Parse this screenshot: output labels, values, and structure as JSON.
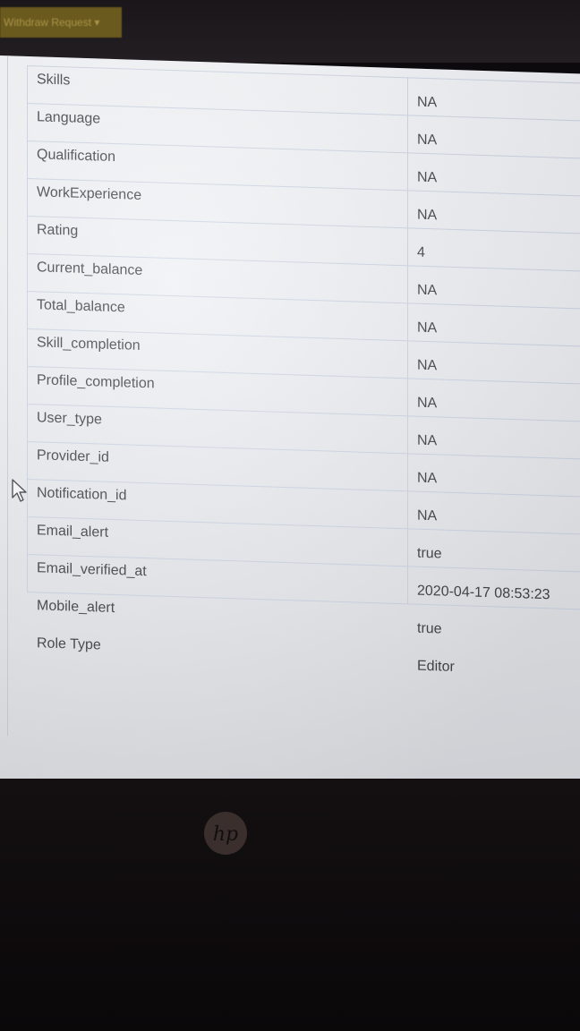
{
  "toolbar": {
    "withdraw_label": "Withdraw Request ▾"
  },
  "details": {
    "rows": [
      {
        "label": "Skills",
        "value": "NA"
      },
      {
        "label": "Language",
        "value": "NA"
      },
      {
        "label": "Qualification",
        "value": "NA"
      },
      {
        "label": "WorkExperience",
        "value": "NA"
      },
      {
        "label": "Rating",
        "value": "4"
      },
      {
        "label": "Current_balance",
        "value": "NA"
      },
      {
        "label": "Total_balance",
        "value": "NA"
      },
      {
        "label": "Skill_completion",
        "value": "NA"
      },
      {
        "label": "Profile_completion",
        "value": "NA"
      },
      {
        "label": "User_type",
        "value": "NA"
      },
      {
        "label": "Provider_id",
        "value": "NA"
      },
      {
        "label": "Notification_id",
        "value": "NA"
      },
      {
        "label": "Email_alert",
        "value": "true"
      },
      {
        "label": "Email_verified_at",
        "value": "2020-04-17 08:53:23"
      },
      {
        "label": "Mobile_alert",
        "value": "true"
      },
      {
        "label": "Role Type",
        "value": "Editor"
      }
    ]
  },
  "icons": {
    "cursor": "mouse-pointer-icon",
    "laptop_logo": "hp-logo-icon"
  },
  "colors": {
    "withdraw_button_bg": "#6a5a1e",
    "screen_bg": "#eceef2",
    "border": "#cbd3e2",
    "text": "#3b3d44"
  }
}
